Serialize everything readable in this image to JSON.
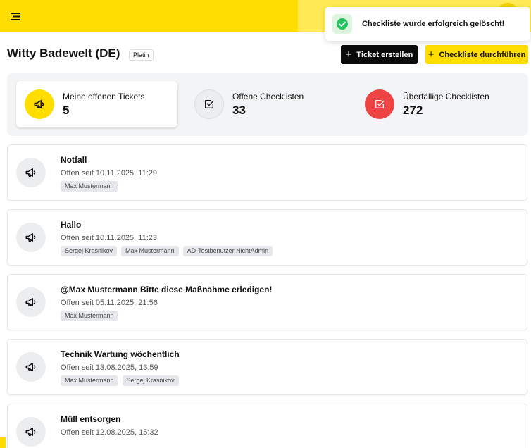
{
  "toast": {
    "message": "Checkliste wurde erfolgreich gelöscht!"
  },
  "page": {
    "title": "Witty Badewelt (DE)",
    "tier": "Platin"
  },
  "actions": {
    "create_ticket": "Ticket erstellen",
    "run_checklist": "Checkliste durchführen"
  },
  "stats": [
    {
      "label": "Meine offenen Tickets",
      "value": "5",
      "icon": "megaphone-icon",
      "color": "#FFDD00"
    },
    {
      "label": "Offene Checklisten",
      "value": "33",
      "icon": "checkbox-icon",
      "color": "#ECEDEF"
    },
    {
      "label": "Überfällige Checklisten",
      "value": "272",
      "icon": "checkbox-icon",
      "color": "#EF4444"
    }
  ],
  "tickets": [
    {
      "title": "Notfall",
      "since": "Offen seit 10.11.2025, 11:29",
      "tags": [
        "Max Mustermann"
      ]
    },
    {
      "title": "Hallo",
      "since": "Offen seit 10.11.2025, 11:23",
      "tags": [
        "Sergej Krasnikov",
        "Max Mustermann",
        "AD-Testbenutzer NichtAdmin"
      ]
    },
    {
      "title": "@Max Mustermann Bitte diese Maßnahme erledigen!",
      "since": "Offen seit 05.11.2025, 21:56",
      "tags": [
        "Max Mustermann"
      ]
    },
    {
      "title": "Technik Wartung wöchentlich",
      "since": "Offen seit 13.08.2025, 13:59",
      "tags": [
        "Max Mustermann",
        "Sergej Krasnikov"
      ]
    },
    {
      "title": "Müll entsorgen",
      "since": "Offen seit 12.08.2025, 15:32",
      "tags": []
    }
  ]
}
